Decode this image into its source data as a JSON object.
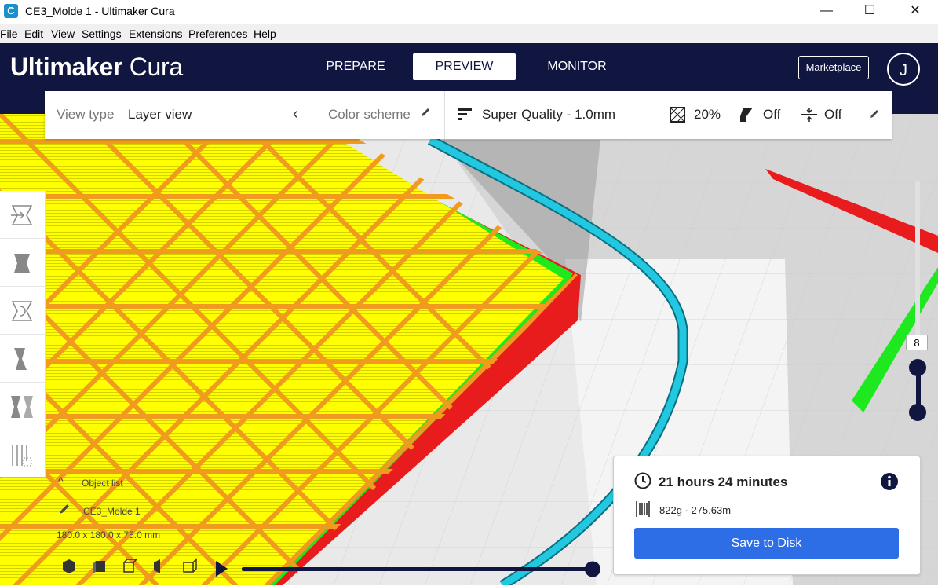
{
  "window": {
    "title": "CE3_Molde 1 - Ultimaker Cura",
    "icon": "cura-icon",
    "minimize": "—",
    "maximize": "☐",
    "close": "✕"
  },
  "menu": [
    "File",
    "Edit",
    "View",
    "Settings",
    "Extensions",
    "Preferences",
    "Help"
  ],
  "brand": {
    "bold": "Ultimaker",
    "light": " Cura"
  },
  "tabs": {
    "prepare": "PREPARE",
    "preview": "PREVIEW",
    "monitor": "MONITOR"
  },
  "header": {
    "marketplace": "Marketplace",
    "avatar_initial": "J"
  },
  "toolbar": {
    "view_type_label": "View type",
    "view_type_value": "Layer view",
    "color_scheme_label": "Color scheme",
    "profile": "Super Quality - 1.0mm",
    "infill": "20%",
    "support": "Off",
    "adhesion": "Off"
  },
  "object_list": {
    "header": "Object list",
    "name": "CE3_Molde 1",
    "dimensions": "180.0 x 180.0 x 75.0 mm"
  },
  "layer": {
    "current": "8"
  },
  "print_info": {
    "time": "21 hours 24 minutes",
    "material": "822g · 275.63m",
    "save_button": "Save to Disk"
  },
  "colors": {
    "header_bg": "#101640",
    "accent_blue": "#2d6ee6",
    "infill": "#f09a1e",
    "skin": "#ffff00",
    "wall_outer": "#e81c1c",
    "wall_inner": "#1ee81e",
    "travel": "#22c8e0"
  }
}
